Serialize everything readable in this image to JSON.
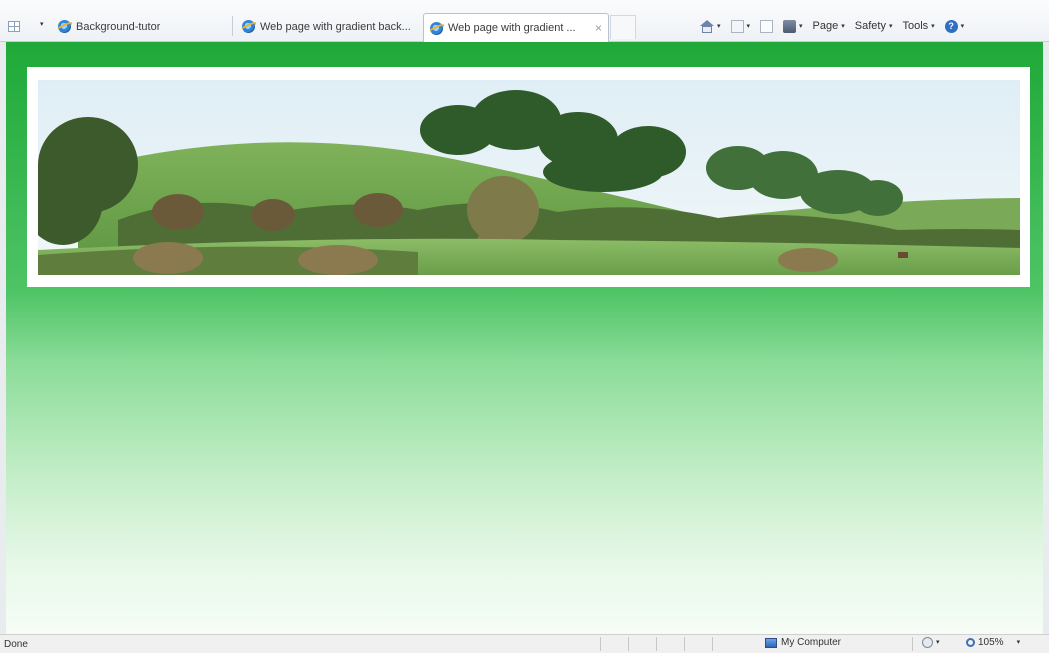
{
  "toolbar": {
    "quick_tabs_icon": "quick-tabs-icon",
    "tabs": [
      {
        "label": "Background-tutor",
        "icon": "ie-page-icon",
        "active": false
      },
      {
        "label": "Web page with gradient back...",
        "icon": "ie-page-icon",
        "active": false
      },
      {
        "label": "Web page with gradient ...",
        "icon": "ie-page-icon",
        "active": true,
        "close": "×"
      }
    ],
    "commands": {
      "home_icon": "home-icon",
      "feeds_icon": "feeds-icon",
      "mail_icon": "read-mail-icon",
      "print_icon": "print-icon",
      "page_label": "Page",
      "safety_label": "Safety",
      "tools_label": "Tools",
      "help_icon": "help-icon",
      "help_glyph": "?",
      "dropdown_glyph": "▾"
    }
  },
  "content": {
    "background_top": "#20a839",
    "background_bottom": "#f6fdf6",
    "banner_alt": "Landscape banner with green hills and trees"
  },
  "statusbar": {
    "status_text": "Done",
    "zone_label": "My Computer",
    "zoom_label": "105%",
    "dropdown_glyph": "▾"
  }
}
